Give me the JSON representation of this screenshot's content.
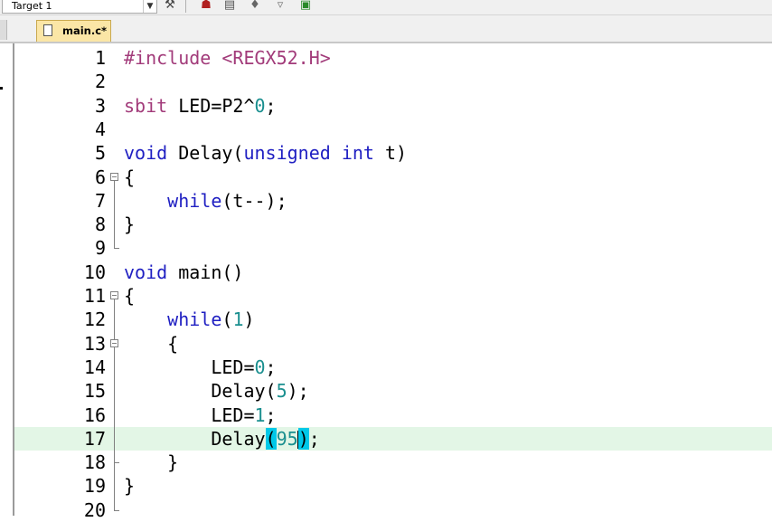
{
  "toolbar": {
    "target_select": "Target 1",
    "icons": [
      "dropdown-arrow-icon",
      "build-wand-icon",
      "options-icon",
      "stack-icon",
      "diamond-icon",
      "filter-icon",
      "target-color-icon"
    ]
  },
  "tabs": [
    {
      "label": "main.c*",
      "active": true
    }
  ],
  "editor": {
    "current_line": 17,
    "lines": [
      {
        "n": "1",
        "segments": [
          {
            "t": "#include <REGX52.H>",
            "c": "pp"
          }
        ]
      },
      {
        "n": "2",
        "segments": []
      },
      {
        "n": "3",
        "segments": [
          {
            "t": "sbit",
            "c": "pp"
          },
          {
            "t": " LED=P2^",
            "c": ""
          },
          {
            "t": "0",
            "c": "num"
          },
          {
            "t": ";",
            "c": ""
          }
        ]
      },
      {
        "n": "4",
        "segments": []
      },
      {
        "n": "5",
        "segments": [
          {
            "t": "void",
            "c": "kw"
          },
          {
            "t": " Delay(",
            "c": ""
          },
          {
            "t": "unsigned",
            "c": "kw"
          },
          {
            "t": " ",
            "c": ""
          },
          {
            "t": "int",
            "c": "kw"
          },
          {
            "t": " t)",
            "c": ""
          }
        ]
      },
      {
        "n": "6",
        "segments": [
          {
            "t": "{",
            "c": ""
          }
        ]
      },
      {
        "n": "7",
        "segments": [
          {
            "t": "    ",
            "c": ""
          },
          {
            "t": "while",
            "c": "kw"
          },
          {
            "t": "(t--);",
            "c": ""
          }
        ]
      },
      {
        "n": "8",
        "segments": [
          {
            "t": "}",
            "c": ""
          }
        ]
      },
      {
        "n": "9",
        "segments": []
      },
      {
        "n": "10",
        "segments": [
          {
            "t": "void",
            "c": "kw"
          },
          {
            "t": " main()",
            "c": ""
          }
        ]
      },
      {
        "n": "11",
        "segments": [
          {
            "t": "{",
            "c": ""
          }
        ]
      },
      {
        "n": "12",
        "segments": [
          {
            "t": "    ",
            "c": ""
          },
          {
            "t": "while",
            "c": "kw"
          },
          {
            "t": "(",
            "c": ""
          },
          {
            "t": "1",
            "c": "num"
          },
          {
            "t": ")",
            "c": ""
          }
        ]
      },
      {
        "n": "13",
        "segments": [
          {
            "t": "    {",
            "c": ""
          }
        ]
      },
      {
        "n": "14",
        "segments": [
          {
            "t": "        LED=",
            "c": ""
          },
          {
            "t": "0",
            "c": "num"
          },
          {
            "t": ";",
            "c": ""
          }
        ]
      },
      {
        "n": "15",
        "segments": [
          {
            "t": "        Delay(",
            "c": ""
          },
          {
            "t": "5",
            "c": "num"
          },
          {
            "t": ");",
            "c": ""
          }
        ]
      },
      {
        "n": "16",
        "segments": [
          {
            "t": "        LED=",
            "c": ""
          },
          {
            "t": "1",
            "c": "num"
          },
          {
            "t": ";",
            "c": ""
          }
        ]
      },
      {
        "n": "17",
        "segments": [
          {
            "t": "        Delay",
            "c": ""
          },
          {
            "t": "(",
            "c": "brace-hl"
          },
          {
            "t": "95",
            "c": "num"
          },
          {
            "t": "|",
            "c": "caret"
          },
          {
            "t": ")",
            "c": "brace-hl"
          },
          {
            "t": ";",
            "c": ""
          }
        ]
      },
      {
        "n": "18",
        "segments": [
          {
            "t": "    }",
            "c": ""
          }
        ]
      },
      {
        "n": "19",
        "segments": [
          {
            "t": "}",
            "c": ""
          }
        ]
      },
      {
        "n": "20",
        "segments": []
      }
    ]
  }
}
